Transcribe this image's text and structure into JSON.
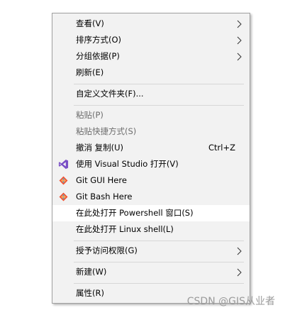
{
  "menu": {
    "view": {
      "label": "查看(V)"
    },
    "sort_by": {
      "label": "排序方式(O)"
    },
    "group_by": {
      "label": "分组依据(P)"
    },
    "refresh": {
      "label": "刷新(E)"
    },
    "customize_folder": {
      "label": "自定义文件夹(F)..."
    },
    "paste": {
      "label": "粘贴(P)"
    },
    "paste_shortcut": {
      "label": "粘贴快捷方式(S)"
    },
    "undo_copy": {
      "label": "撤消 复制(U)",
      "shortcut": "Ctrl+Z"
    },
    "open_vs": {
      "label": "使用 Visual Studio 打开(V)",
      "icon": "visual-studio-icon"
    },
    "git_gui": {
      "label": "Git GUI Here",
      "icon": "git-icon"
    },
    "git_bash": {
      "label": "Git Bash Here",
      "icon": "git-icon"
    },
    "open_powershell": {
      "label": "在此处打开 Powershell 窗口(S)"
    },
    "open_linux_shell": {
      "label": "在此处打开 Linux shell(L)"
    },
    "grant_access": {
      "label": "授予访问权限(G)"
    },
    "new": {
      "label": "新建(W)"
    },
    "properties": {
      "label": "属性(R)"
    }
  },
  "colors": {
    "menu_background": "#f2f2f2",
    "highlight": "#ffffff",
    "disabled_text": "#6d6d6d",
    "vs_purple": "#7a4fc6",
    "git_orange": "#f05133"
  },
  "watermark": {
    "text": "CSDN @GIS从业者"
  }
}
